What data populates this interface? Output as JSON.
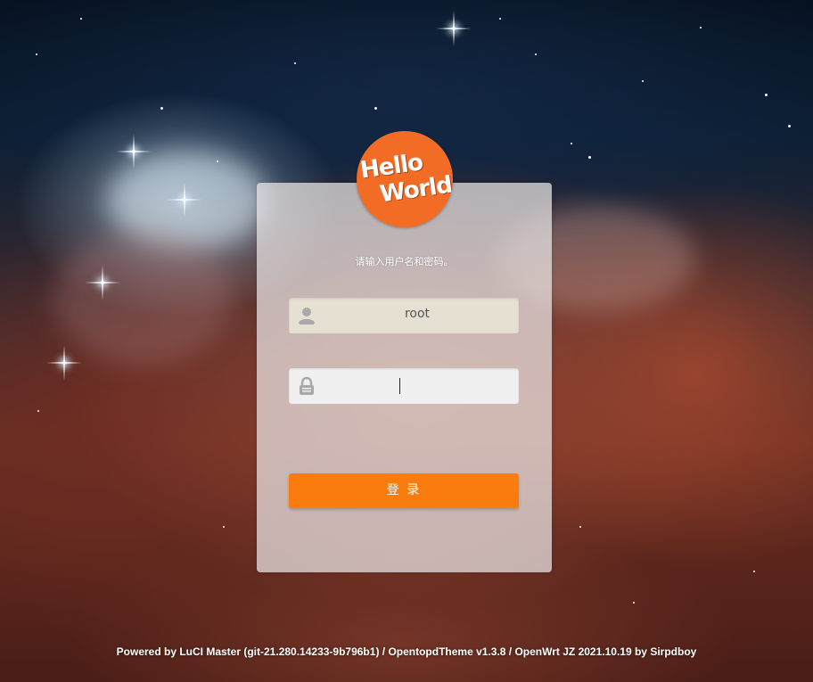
{
  "logo": {
    "line1": "Hello",
    "line2": "World",
    "color": "#f26c25"
  },
  "login": {
    "prompt": "请输入用户名和密码。",
    "username": {
      "value": "root",
      "icon": "user-icon"
    },
    "password": {
      "value": "",
      "icon": "lock-icon"
    },
    "submit_label": "登 录",
    "accent": "#fa7b0e"
  },
  "footer": {
    "text": "Powered by LuCI Master (git-21.280.14233-9b796b1) / OpentopdTheme v1.3.8 / OpenWrt JZ 2021.10.19 by Sirpdboy"
  }
}
